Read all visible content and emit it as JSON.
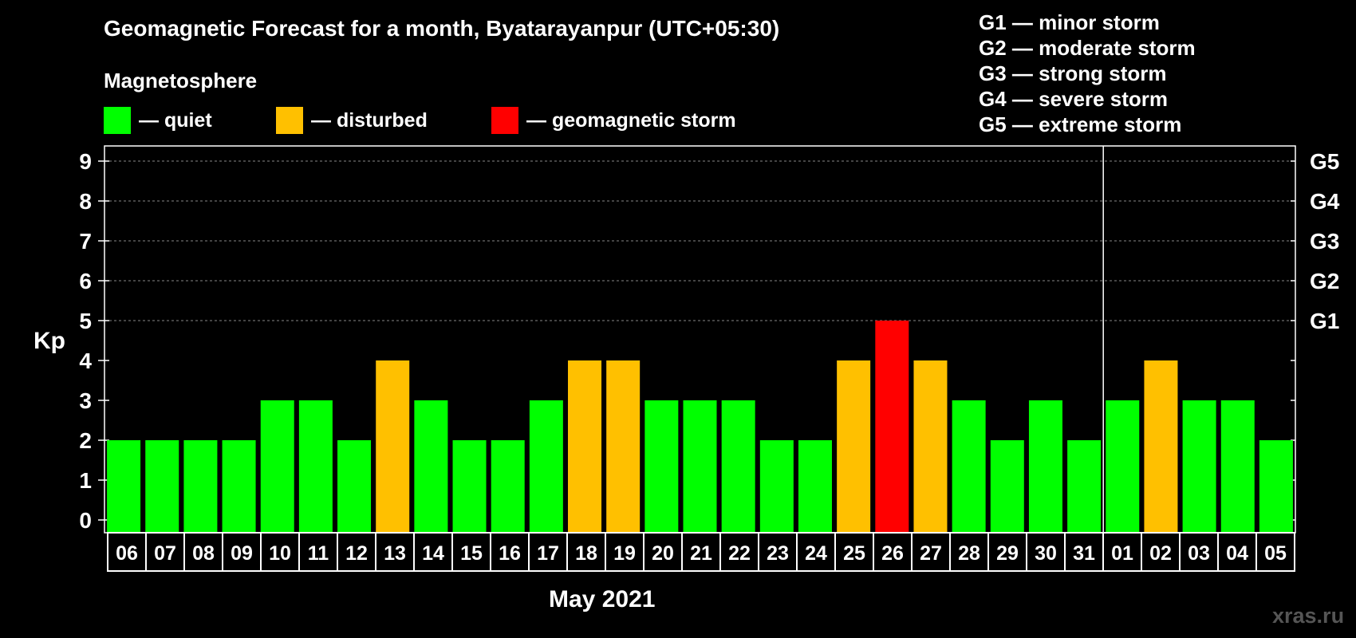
{
  "header": {
    "title": "Geomagnetic Forecast for a month, Byatarayanpur (UTC+05:30)",
    "subtitle": "Magnetosphere"
  },
  "legend": [
    {
      "label": "— quiet",
      "color": "#00ff00"
    },
    {
      "label": "— disturbed",
      "color": "#ffc000"
    },
    {
      "label": "— geomagnetic storm",
      "color": "#ff0000"
    }
  ],
  "storm_legend": [
    "G1 — minor storm",
    "G2 — moderate storm",
    "G3 — strong storm",
    "G4 — severe storm",
    "G5 — extreme storm"
  ],
  "watermark": "xras.ru",
  "chart_data": {
    "type": "bar",
    "ylabel": "Kp",
    "xlabel": "May 2021",
    "ylim": [
      0,
      9
    ],
    "yticks": [
      "0",
      "1",
      "2",
      "3",
      "4",
      "5",
      "6",
      "7",
      "8",
      "9"
    ],
    "right_axis": [
      {
        "value": 5,
        "label": "G1"
      },
      {
        "value": 6,
        "label": "G2"
      },
      {
        "value": 7,
        "label": "G3"
      },
      {
        "value": 8,
        "label": "G4"
      },
      {
        "value": 9,
        "label": "G5"
      }
    ],
    "grid": "dashed lines at Kp 5–9",
    "month_separator_after": "31",
    "categories": [
      "06",
      "07",
      "08",
      "09",
      "10",
      "11",
      "12",
      "13",
      "14",
      "15",
      "16",
      "17",
      "18",
      "19",
      "20",
      "21",
      "22",
      "23",
      "24",
      "25",
      "26",
      "27",
      "28",
      "29",
      "30",
      "31",
      "01",
      "02",
      "03",
      "04",
      "05"
    ],
    "values": [
      2,
      2,
      2,
      2,
      3,
      3,
      2,
      4,
      3,
      2,
      2,
      3,
      4,
      4,
      3,
      3,
      3,
      2,
      2,
      4,
      5,
      4,
      3,
      2,
      3,
      2,
      3,
      4,
      3,
      3,
      2
    ],
    "colors": {
      "quiet": "#00ff00",
      "disturbed": "#ffc000",
      "storm": "#ff0000"
    }
  }
}
